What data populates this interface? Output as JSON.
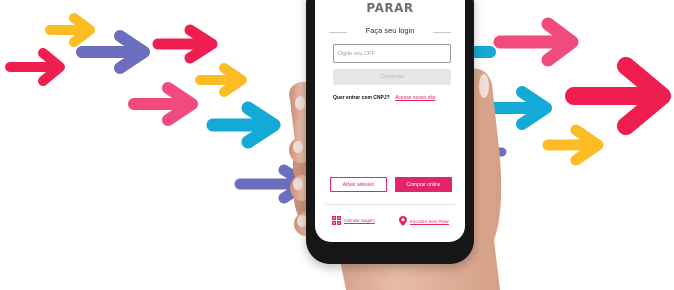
{
  "colors": {
    "brand_pink": "#e1246b",
    "arrow_yellow": "#fbbd23",
    "arrow_purple": "#6c6fbf",
    "arrow_red": "#f01e50",
    "arrow_pink": "#f04a7e",
    "arrow_cyan": "#14a9d6"
  },
  "app": {
    "brand": "PARAR"
  },
  "login": {
    "heading": "Faça seu login",
    "cpf_placeholder": "Digite seu CPF",
    "continue_label": "Continuar",
    "cnpj_question": "Quer entrar com CNPJ?",
    "cnpj_link": "Acesse nosso site"
  },
  "actions": {
    "activate_label": "Ativar adesivo",
    "buy_label": "Comprar online"
  },
  "footer": {
    "calc_label": "Calcular viagem",
    "calc_icon": "calculator-icon",
    "find_label": "Encontre Sem Parar",
    "find_icon": "location-pin-icon"
  }
}
